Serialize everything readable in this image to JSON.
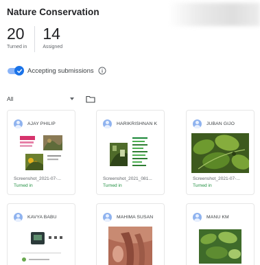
{
  "assignment": {
    "title": "Nature Conservation"
  },
  "stats": {
    "turned_in": {
      "count": "20",
      "label": "Turned in"
    },
    "assigned": {
      "count": "14",
      "label": "Assigned"
    }
  },
  "submissions_toggle": {
    "label": "Accepting submissions",
    "on": true
  },
  "filter": {
    "selected": "All"
  },
  "colors": {
    "accent": "#1a73e8",
    "toggle_track": "#8ab4f8",
    "turned_in_green": "#1e8e3e",
    "avatar": "#8fb3ef"
  },
  "icons": {
    "toggle": "check-icon",
    "info": "info-icon",
    "dropdown": "chevron-down-icon",
    "folder": "folder-icon",
    "avatar": "person-icon"
  },
  "students": [
    {
      "name": "AJAY PHILIP",
      "file": "Screenshot_2021-07-...",
      "status": "Turned in"
    },
    {
      "name": "HARIKRISHNAN K",
      "file": "Screenshot_2021_081...",
      "status": "Turned in"
    },
    {
      "name": "JUBAN GIJO",
      "file": "Screenshot_2021-07-...",
      "status": "Turned in"
    },
    {
      "name": "KAVYA BABU"
    },
    {
      "name": "MAHIMA SUSAN"
    },
    {
      "name": "MANU KM"
    }
  ]
}
